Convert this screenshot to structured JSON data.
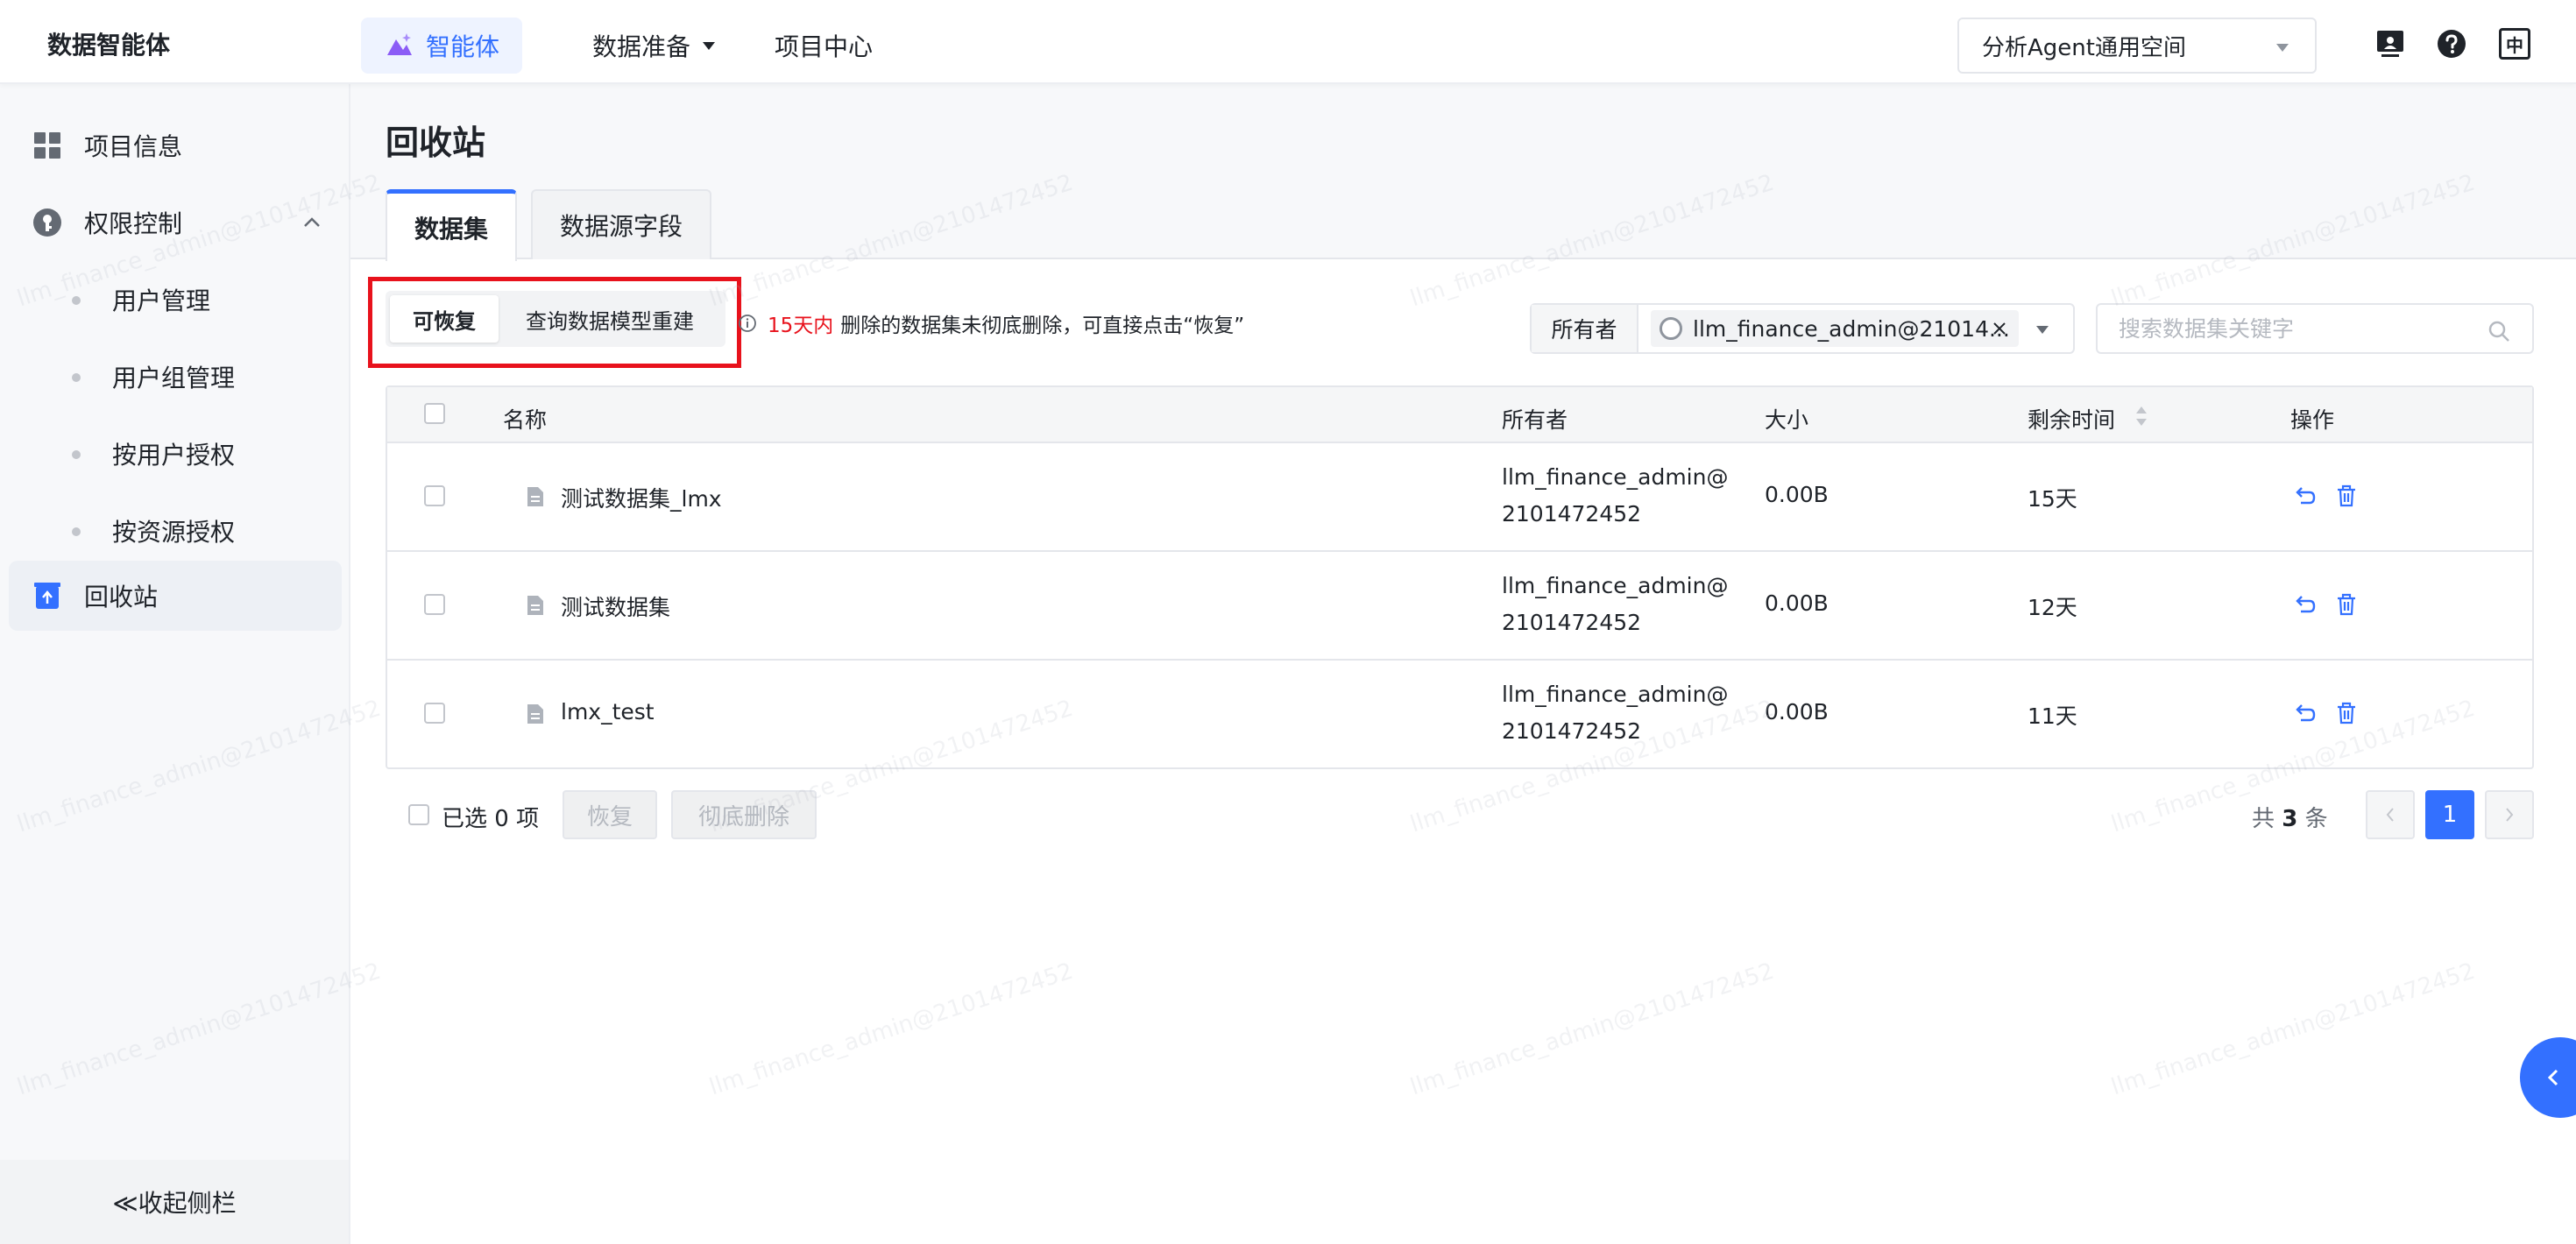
{
  "header": {
    "app_title": "数据智能体",
    "nav": {
      "agent": "智能体",
      "data_prep": "数据准备",
      "project_center": "项目中心"
    },
    "workspace": "分析Agent通用空间",
    "icons": [
      "monitor-icon",
      "help-icon",
      "language-icon"
    ],
    "language_label": "中"
  },
  "sidebar": {
    "items": [
      {
        "label": "项目信息",
        "icon": "grid-icon"
      },
      {
        "label": "权限控制",
        "icon": "key-icon"
      },
      {
        "label": "回收站",
        "icon": "recycle-icon"
      }
    ],
    "sub_items": [
      "用户管理",
      "用户组管理",
      "按用户授权",
      "按资源授权"
    ],
    "collapse_label": "≪收起侧栏"
  },
  "page": {
    "title": "回收站",
    "tabs": [
      "数据集",
      "数据源字段"
    ],
    "segmented": [
      "可恢复",
      "查询数据模型重建"
    ],
    "notice": {
      "highlight": "15天内",
      "text": "删除的数据集未彻底删除，可直接点击“恢复”"
    },
    "owner_filter": {
      "label": "所有者",
      "value": "llm_finance_admin@21014..."
    },
    "search_placeholder": "搜索数据集关键字"
  },
  "table": {
    "columns": [
      "名称",
      "所有者",
      "大小",
      "剩余时间",
      "操作"
    ],
    "rows": [
      {
        "name": "测试数据集_lmx",
        "owner": "llm_finance_admin@2101472452",
        "size": "0.00B",
        "remaining": "15天"
      },
      {
        "name": "测试数据集",
        "owner": "llm_finance_admin@2101472452",
        "size": "0.00B",
        "remaining": "12天"
      },
      {
        "name": "lmx_test",
        "owner": "llm_finance_admin@2101472452",
        "size": "0.00B",
        "remaining": "11天"
      }
    ]
  },
  "footer": {
    "selected_text": "已选 0 项",
    "restore_button": "恢复",
    "delete_button": "彻底删除",
    "total_prefix": "共",
    "total_count": "3",
    "total_suffix": "条",
    "current_page": "1"
  },
  "watermark": "llm_finance_admin@2101472452",
  "colors": {
    "accent": "#3370ff",
    "highlight_red": "#e8121c"
  }
}
